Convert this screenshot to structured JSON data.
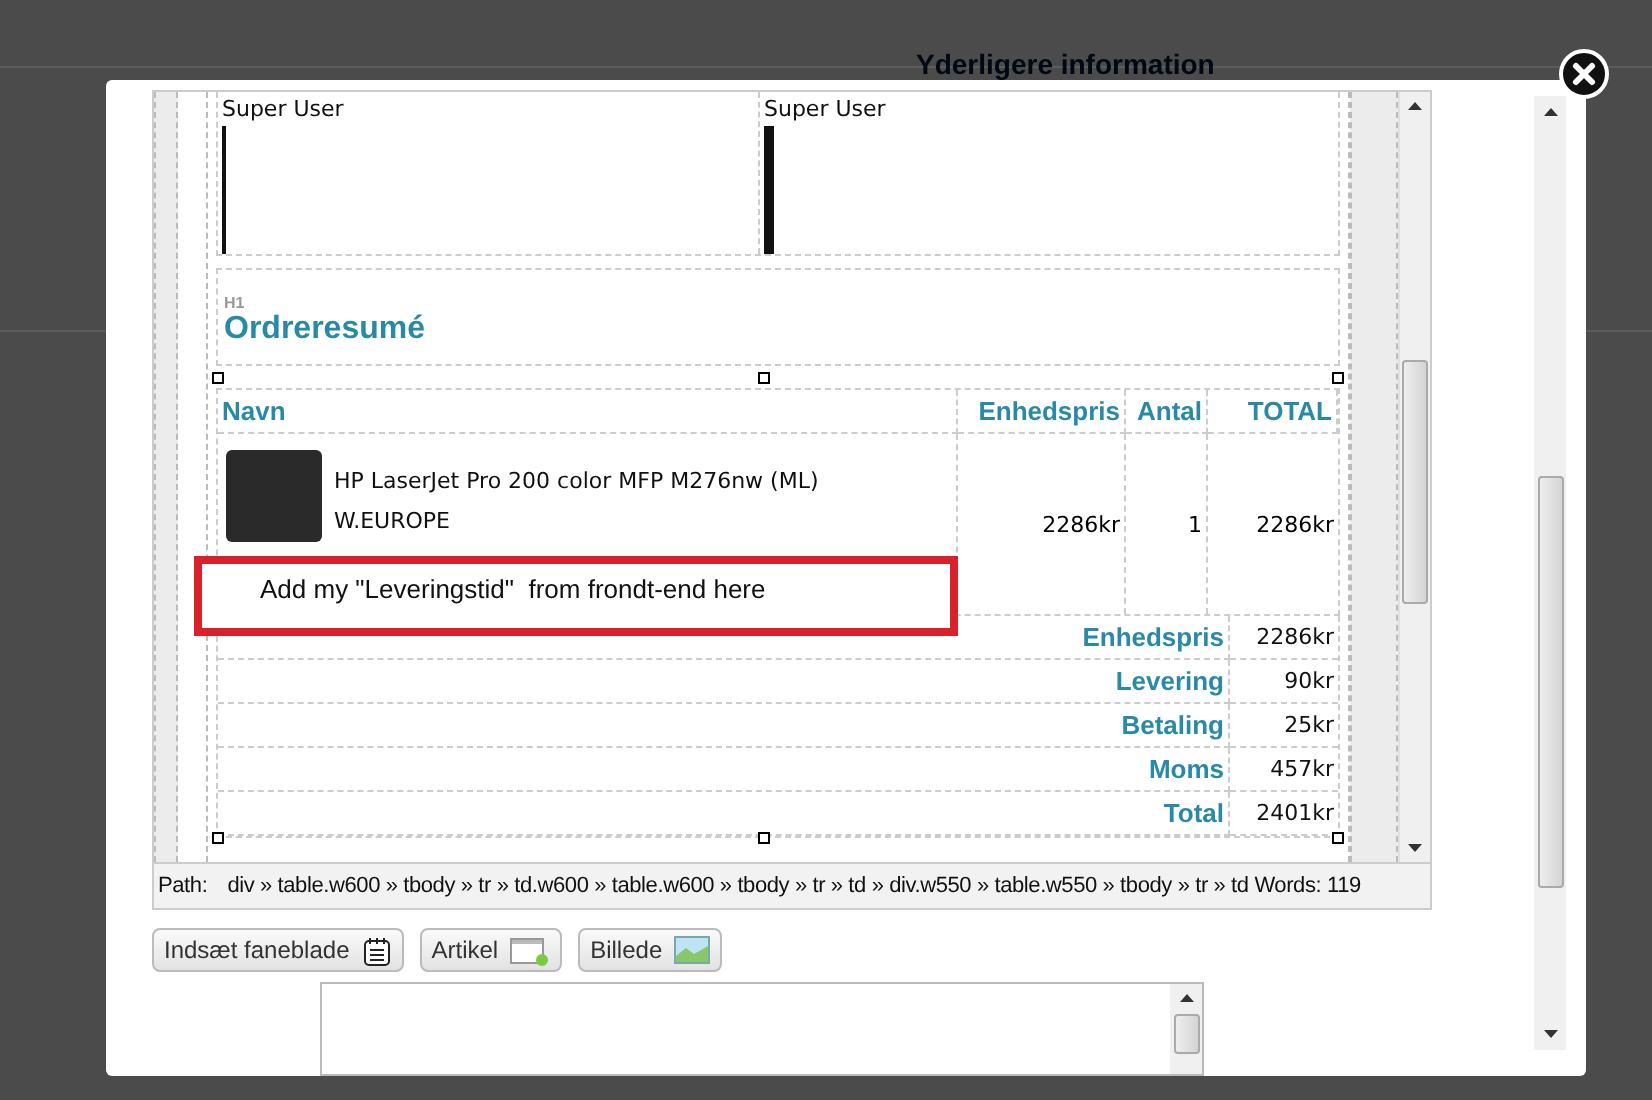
{
  "background": {
    "heading": "Yderligere information"
  },
  "editor": {
    "signature_cells": [
      "Super User",
      "Super User"
    ],
    "heading_tag": "H1",
    "heading": "Ordreresumé",
    "table": {
      "columns": [
        "Navn",
        "Enhedspris",
        "Antal",
        "TOTAL"
      ],
      "rows": [
        {
          "name": "HP LaserJet Pro 200 color MFP M276nw (ML) W.EUROPE",
          "unit_price": "2286kr",
          "quantity": "1",
          "total": "2286kr"
        }
      ]
    },
    "annotation": "Add my \"Leveringstid\"  from frondt-end here",
    "summary": [
      {
        "label": "Enhedspris",
        "value": "2286kr"
      },
      {
        "label": "Levering",
        "value": "90kr"
      },
      {
        "label": "Betaling",
        "value": "25kr"
      },
      {
        "label": "Moms",
        "value": "457kr"
      },
      {
        "label": "Total",
        "value": "2401kr"
      }
    ],
    "path_bar": {
      "label": "Path:",
      "path": "div » table.w600 » tbody » tr » td.w600 » table.w600 » tbody » tr » td » div.w550 » table.w550 » tbody » tr » td",
      "words": "Words: 119"
    }
  },
  "buttons": [
    {
      "label": "Indsæt faneblade",
      "kind": "tabs"
    },
    {
      "label": "Artikel",
      "kind": "article"
    },
    {
      "label": "Billede",
      "kind": "image"
    }
  ]
}
